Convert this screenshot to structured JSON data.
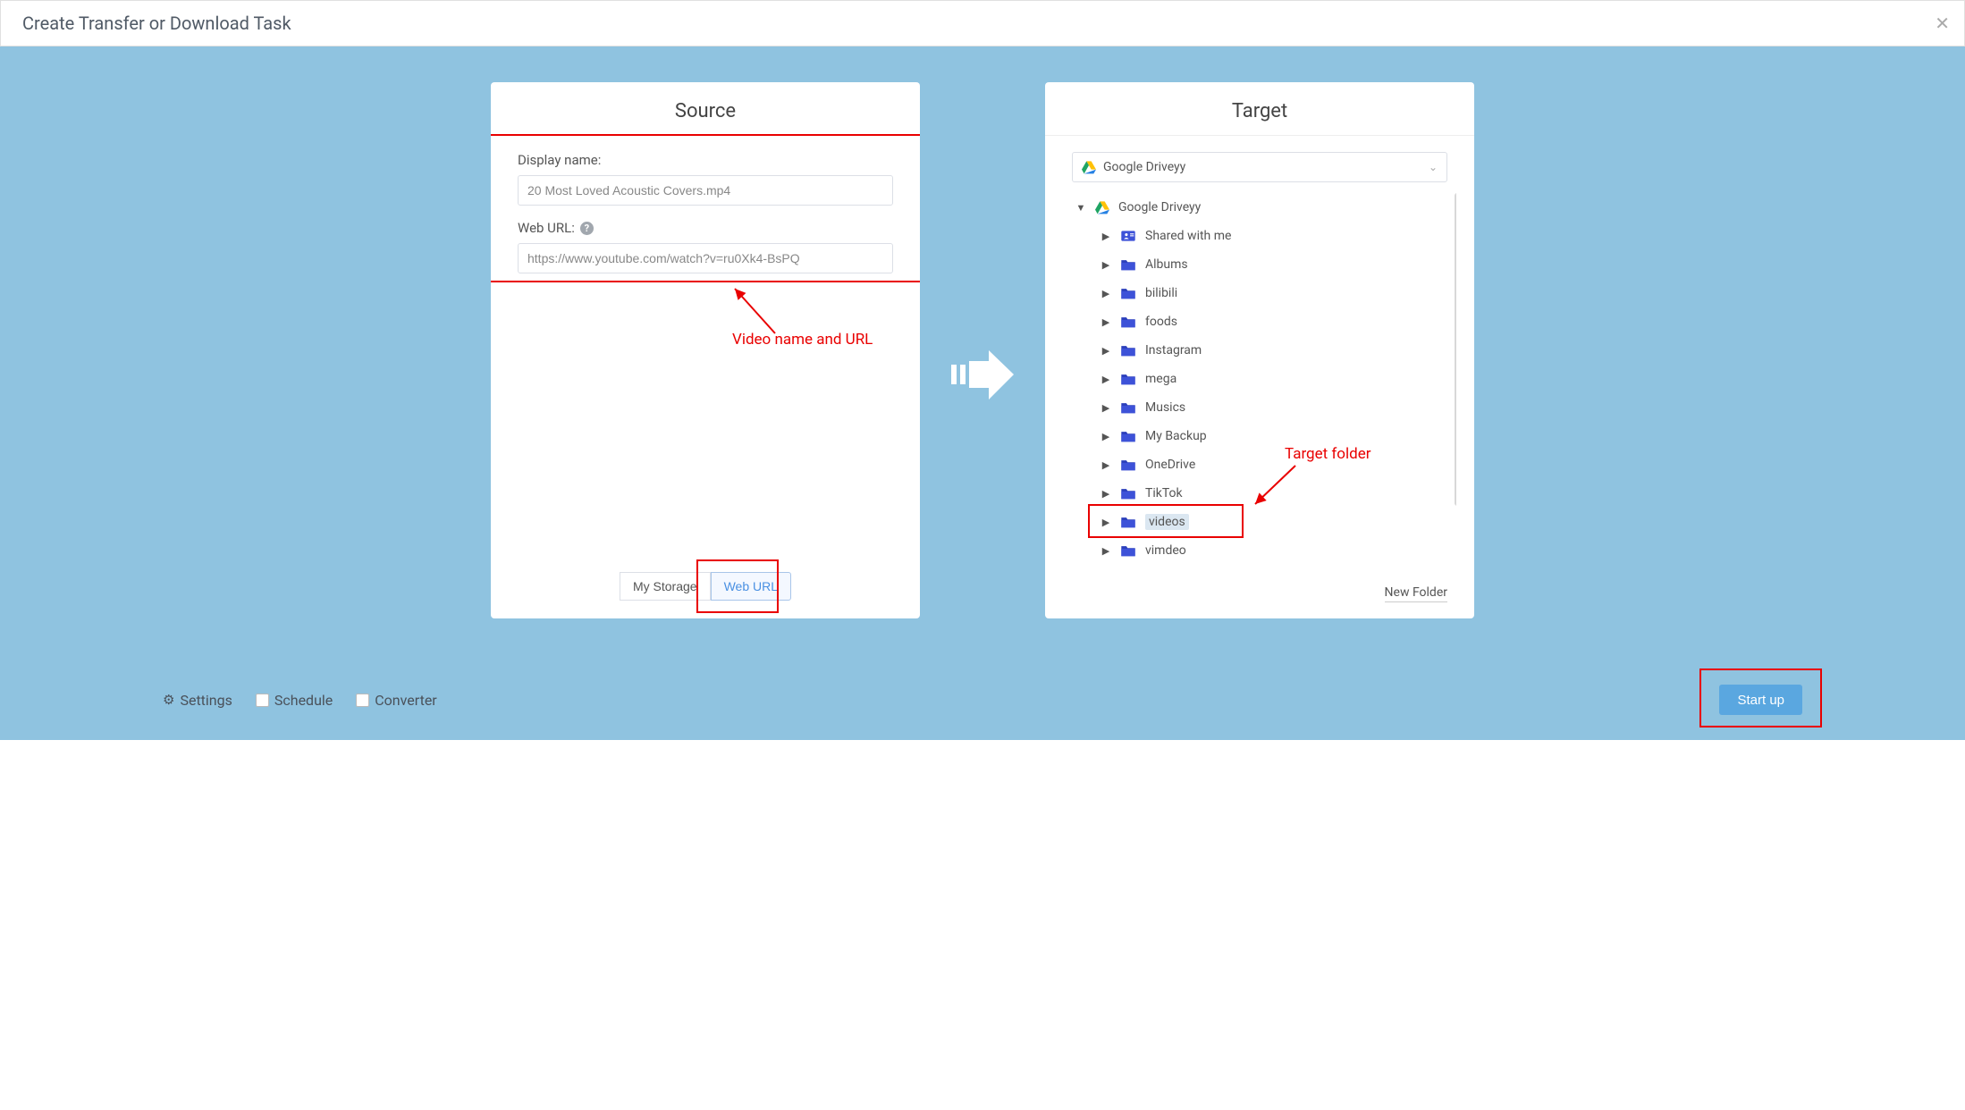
{
  "header": {
    "title": "Create Transfer or Download Task"
  },
  "source": {
    "title": "Source",
    "display_name_label": "Display name:",
    "display_name_value": "20 Most Loved Acoustic Covers.mp4",
    "web_url_label": "Web URL:",
    "web_url_value": "https://www.youtube.com/watch?v=ru0Xk4-BsPQ",
    "tabs": {
      "my_storage": "My Storage",
      "web_url": "Web URL"
    }
  },
  "target": {
    "title": "Target",
    "selected": "Google Driveyy",
    "root": "Google Driveyy",
    "items": [
      {
        "name": "Shared with me",
        "icon": "shared"
      },
      {
        "name": "Albums",
        "icon": "folder"
      },
      {
        "name": "bilibili",
        "icon": "folder"
      },
      {
        "name": "foods",
        "icon": "folder"
      },
      {
        "name": "Instagram",
        "icon": "folder"
      },
      {
        "name": "mega",
        "icon": "folder"
      },
      {
        "name": "Musics",
        "icon": "folder"
      },
      {
        "name": "My Backup",
        "icon": "folder"
      },
      {
        "name": "OneDrive",
        "icon": "folder"
      },
      {
        "name": "TikTok",
        "icon": "folder"
      },
      {
        "name": "videos",
        "icon": "folder",
        "selected": true
      },
      {
        "name": "vimdeo",
        "icon": "folder"
      }
    ],
    "new_folder": "New Folder"
  },
  "bottom": {
    "settings": "Settings",
    "schedule": "Schedule",
    "converter": "Converter",
    "start": "Start up"
  },
  "annotations": {
    "source_note": "Video name and URL",
    "target_note": "Target folder"
  }
}
